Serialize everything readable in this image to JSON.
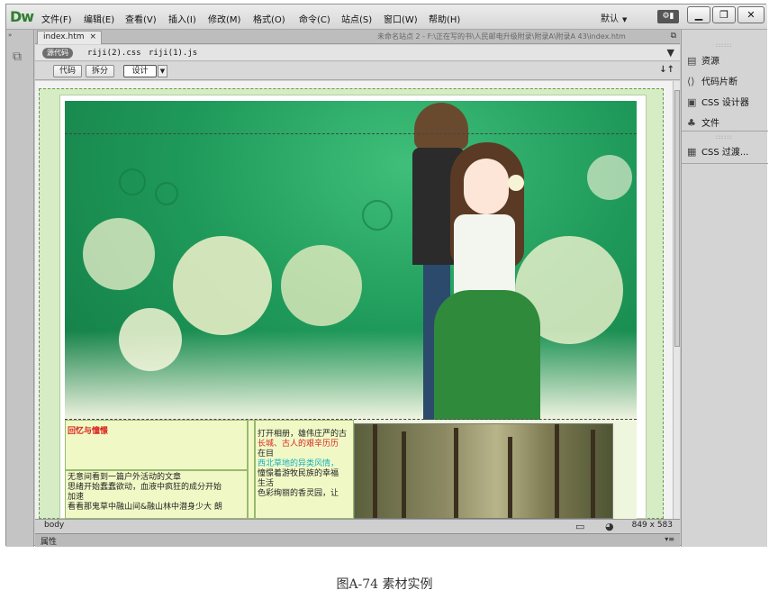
{
  "app": {
    "logo": "Dw",
    "menus": [
      "文件(F)",
      "编辑(E)",
      "查看(V)",
      "插入(I)",
      "修改(M)",
      "格式(O)",
      "命令(C)",
      "站点(S)",
      "窗口(W)",
      "帮助(H)"
    ],
    "workspace": "默认",
    "window_controls": [
      "_",
      "ø",
      "×"
    ]
  },
  "document": {
    "tab": "index.htm",
    "path": "未命名站点 2 - F:\\正在写的书\\人民邮电升级附录\\附录A\\附录A 43\\index.htm",
    "source_button": "源代码",
    "related_files": [
      "riji(2).css",
      "riji(1).js"
    ],
    "view_buttons": [
      "代码",
      "拆分",
      "设计"
    ]
  },
  "content": {
    "cell_title": "回忆与憧憬",
    "left_text_lines": [
      "无意间看到一篇户外活动的文章",
      "思绪开始蠢蠢欲动，血液中疯狂的成分开始",
      "加速",
      "看看那鬼草中融山间&融山林中潜身少大 朗"
    ],
    "right_text_lines": [
      "打开相册，雄伟庄严的古",
      "长城、古人的艰辛历历",
      "在目",
      "西北草地的异类风情，",
      "憧憬着游牧民族的幸福",
      "生活",
      "色彩绚丽的香灵园，让"
    ]
  },
  "status": {
    "tag": "body",
    "size": "849 x 583"
  },
  "properties": {
    "label": "属性"
  },
  "panels": {
    "items": [
      "资源",
      "代码片断",
      "CSS 设计器",
      "文件",
      "CSS 过渡..."
    ]
  },
  "caption": "图A-74 素材实例"
}
